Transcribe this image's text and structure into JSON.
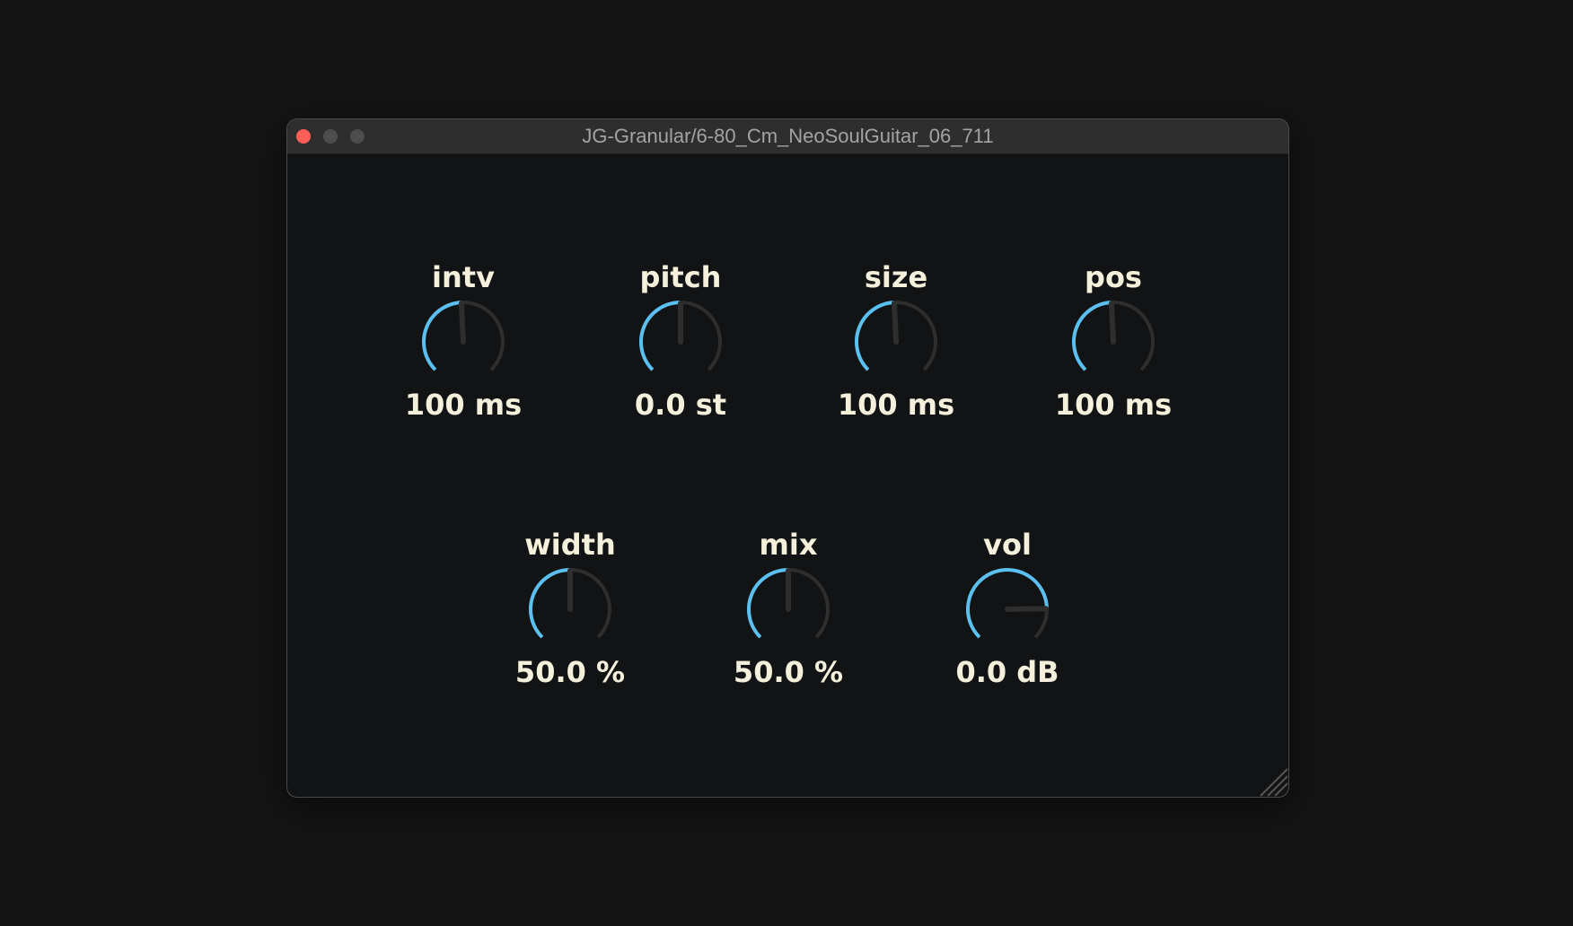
{
  "window": {
    "title": "JG-Granular/6-80_Cm_NeoSoulGuitar_06_711"
  },
  "colors": {
    "accent": "#5bc0f0",
    "track": "#2e2e2e",
    "text": "#f5f0dc"
  },
  "knobs": [
    {
      "id": "intv",
      "label": "intv",
      "value_text": "100 ms",
      "value": 0.49
    },
    {
      "id": "pitch",
      "label": "pitch",
      "value_text": "0.0 st",
      "value": 0.5
    },
    {
      "id": "size",
      "label": "size",
      "value_text": "100 ms",
      "value": 0.49
    },
    {
      "id": "pos",
      "label": "pos",
      "value_text": "100 ms",
      "value": 0.49
    },
    {
      "id": "width",
      "label": "width",
      "value_text": "50.0 %",
      "value": 0.5
    },
    {
      "id": "mix",
      "label": "mix",
      "value_text": "50.0 %",
      "value": 0.5
    },
    {
      "id": "vol",
      "label": "vol",
      "value_text": "0.0 dB",
      "value": 0.83
    }
  ]
}
